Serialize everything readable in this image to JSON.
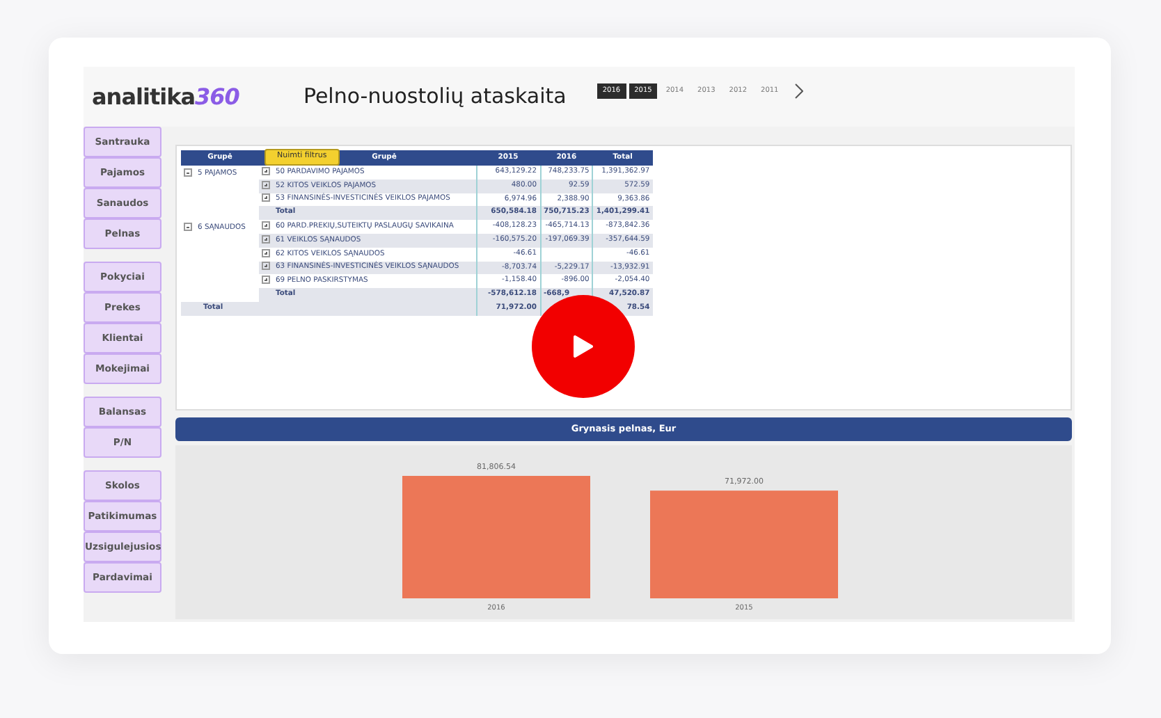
{
  "header": {
    "logo": {
      "text": "analitika",
      "accent": "360"
    },
    "title": "Pelno-nuostolių ataskaita",
    "years": [
      {
        "label": "2016",
        "selected": true
      },
      {
        "label": "2015",
        "selected": true
      },
      {
        "label": "2014",
        "selected": false
      },
      {
        "label": "2013",
        "selected": false
      },
      {
        "label": "2012",
        "selected": false
      },
      {
        "label": "2011",
        "selected": false
      }
    ]
  },
  "sidebar": {
    "groups": [
      [
        "Santrauka",
        "Pajamos",
        "Sanaudos",
        "Pelnas"
      ],
      [
        "Pokyciai",
        "Prekes",
        "Klientai",
        "Mokejimai"
      ],
      [
        "Balansas",
        "P/N"
      ],
      [
        "Skolos",
        "Patikimumas",
        "Uzsigulejusios",
        "Pardavimai"
      ]
    ]
  },
  "table": {
    "columns": [
      "Grupė",
      "Grupė",
      "2015",
      "2016",
      "Total"
    ],
    "filter_button": "Nuimti filtrus",
    "groups": [
      {
        "label": "5 PAJAMOS",
        "expanded": true,
        "rows": [
          {
            "label": "50 PARDAVIMO PAJAMOS",
            "expanded": false,
            "cells": {
              "col_2015": "643,129.22",
              "col_2016": "748,233.75",
              "col_total": "1,391,362.97"
            }
          },
          {
            "label": "52 KITOS VEIKLOS PAJAMOS",
            "expanded": false,
            "cells": {
              "col_2015": "480.00",
              "col_2016": "92.59",
              "col_total": "572.59"
            }
          },
          {
            "label": "53 FINANSINĖS-INVESTICINĖS VEIKLOS PAJAMOS",
            "expanded": false,
            "cells": {
              "col_2015": "6,974.96",
              "col_2016": "2,388.90",
              "col_total": "9,363.86"
            }
          }
        ],
        "total": {
          "label": "Total",
          "cells": {
            "col_2015": "650,584.18",
            "col_2016": "750,715.23",
            "col_total": "1,401,299.41"
          }
        }
      },
      {
        "label": "6 SĄNAUDOS",
        "expanded": true,
        "rows": [
          {
            "label": "60 PARD.PREKIŲ,SUTEIKTŲ PASLAUGŲ SAVIKAINA",
            "expanded": false,
            "cells": {
              "col_2015": "-408,128.23",
              "col_2016": "-465,714.13",
              "col_total": "-873,842.36"
            }
          },
          {
            "label": "61 VEIKLOS SĄNAUDOS",
            "expanded": false,
            "cells": {
              "col_2015": "-160,575.20",
              "col_2016": "-197,069.39",
              "col_total": "-357,644.59"
            }
          },
          {
            "label": "62 KITOS VEIKLOS SĄNAUDOS",
            "expanded": false,
            "cells": {
              "col_2015": "-46.61",
              "col_total": "-46.61"
            }
          },
          {
            "label": "63 FINANSINĖS-INVESTICINĖS VEIKLOS SĄNAUDOS",
            "expanded": false,
            "cells": {
              "col_2015": "-8,703.74",
              "col_2016": "-5,229.17",
              "col_total": "-13,932.91"
            }
          },
          {
            "label": "69 PELNO PASKIRSTYMAS",
            "expanded": false,
            "cells": {
              "col_2015": "-1,158.40",
              "col_2016": "-896.00",
              "col_total": "-2,054.40"
            }
          }
        ],
        "total": {
          "label": "Total",
          "cells": {
            "col_2015": "-578,612.18",
            "col_2016": "-668,9",
            "col_total": "47,520.87"
          }
        }
      }
    ],
    "grand_total": {
      "label": "Total",
      "cells": {
        "col_2015": "71,972.00",
        "col_total": "78.54"
      }
    }
  },
  "chart": {
    "title": "Grynasis pelnas, Eur",
    "chart_data": {
      "type": "bar",
      "categories": [
        "2016",
        "2015"
      ],
      "values": [
        81806.54,
        71972.0
      ],
      "data_labels": true,
      "value_labels": [
        "81,806.54",
        "71,972.00"
      ]
    }
  }
}
